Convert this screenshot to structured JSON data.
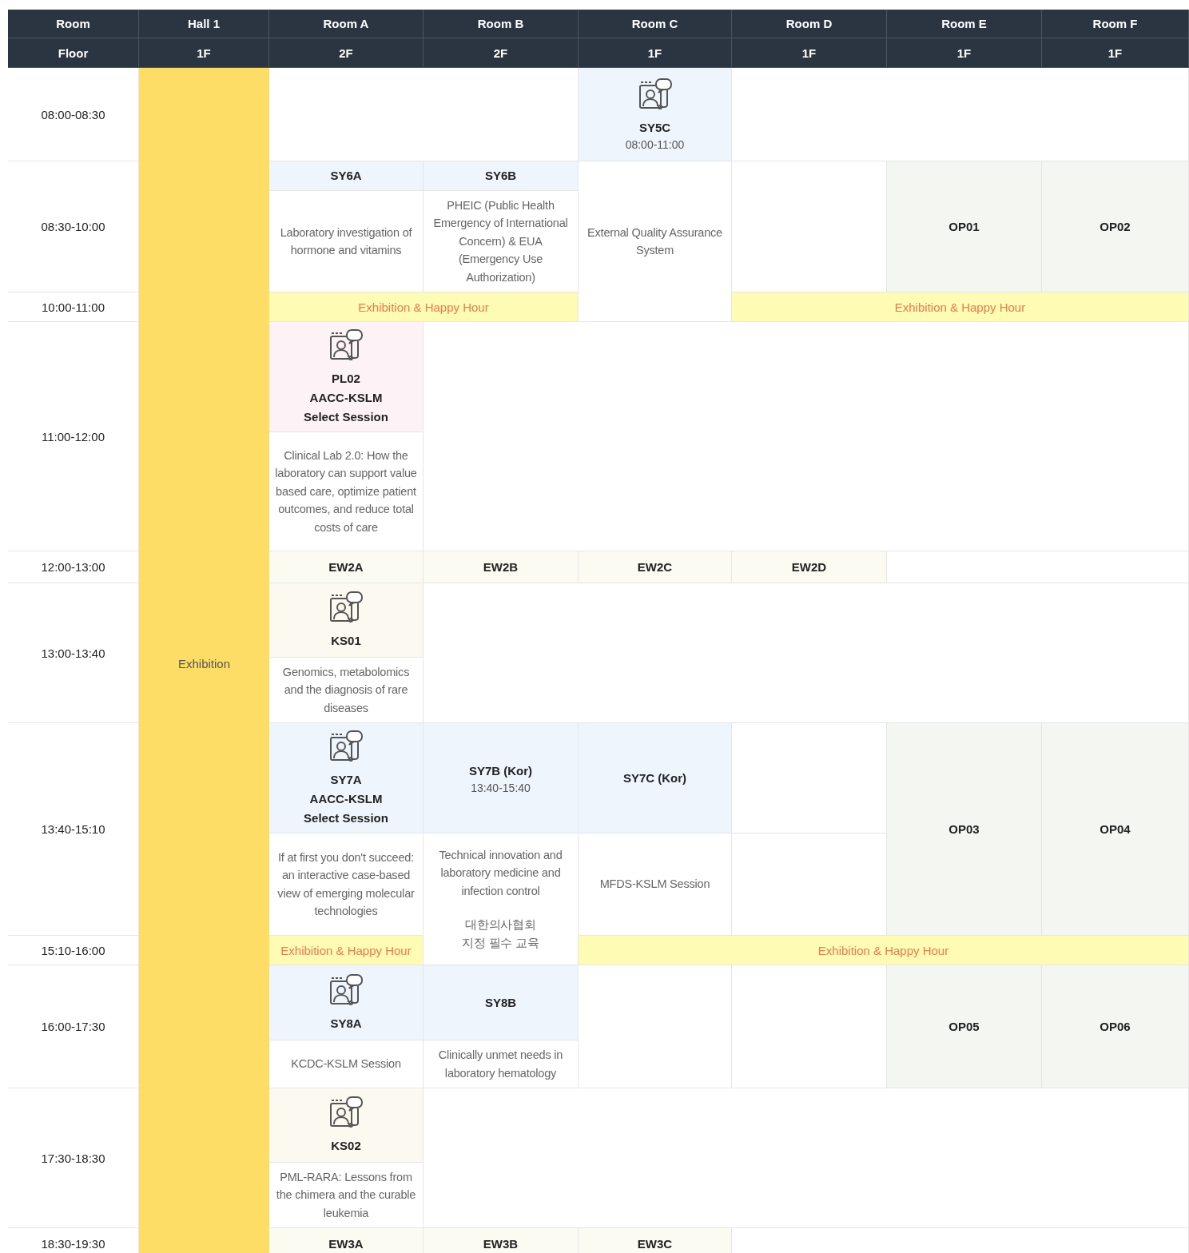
{
  "columns": [
    {
      "room": "Room",
      "floor": "Floor"
    },
    {
      "room": "Hall 1",
      "floor": "1F"
    },
    {
      "room": "Room A",
      "floor": "2F"
    },
    {
      "room": "Room B",
      "floor": "2F"
    },
    {
      "room": "Room C",
      "floor": "1F"
    },
    {
      "room": "Room D",
      "floor": "1F"
    },
    {
      "room": "Room E",
      "floor": "1F"
    },
    {
      "room": "Room F",
      "floor": "1F"
    }
  ],
  "time_slots": [
    "08:00-08:30",
    "08:30-10:00",
    "10:00-11:00",
    "11:00-12:00",
    "12:00-13:00",
    "13:00-13:40",
    "13:40-15:10",
    "15:10-16:00",
    "16:00-17:30",
    "17:30-18:30",
    "18:30-19:30"
  ],
  "hall": {
    "label": "Exhibition"
  },
  "cells": [
    {
      "kind": "session",
      "lines": [
        "SY5C"
      ],
      "time": "08:00-11:00",
      "icon": true,
      "color": "#eef5fc"
    },
    {
      "kind": "session",
      "lines": [
        "SY6A"
      ],
      "icon": false,
      "color": "#eef5fc"
    },
    {
      "kind": "session",
      "lines": [
        "SY6B"
      ],
      "icon": false,
      "color": "#eef5fc"
    },
    {
      "kind": "description",
      "text": "Laboratory investigation of hormone and vitamins"
    },
    {
      "kind": "description",
      "text": "PHEIC (Public Health Emergency of International Concern) & EUA (Emergency Use Authorization)"
    },
    {
      "kind": "description",
      "text": "External Quality Assurance System"
    },
    {
      "kind": "session",
      "lines": [
        "OP01"
      ],
      "icon": false,
      "color": "#f4f7f1"
    },
    {
      "kind": "session",
      "lines": [
        "OP02"
      ],
      "icon": false,
      "color": "#f4f7f1"
    },
    {
      "kind": "band",
      "text": "Exhibition & Happy Hour"
    },
    {
      "kind": "band",
      "text": "Exhibition & Happy Hour"
    },
    {
      "kind": "session",
      "lines": [
        "PL02",
        "AACC-KSLM",
        "Select Session"
      ],
      "icon": true,
      "color": "#fdf3f7"
    },
    {
      "kind": "description",
      "text": "Clinical Lab 2.0: How the laboratory can support value based care, optimize patient outcomes, and reduce total costs of care"
    },
    {
      "kind": "session",
      "lines": [
        "EW2A"
      ],
      "icon": false,
      "color": "#fcfbf1"
    },
    {
      "kind": "session",
      "lines": [
        "EW2B"
      ],
      "icon": false,
      "color": "#fcfbf1"
    },
    {
      "kind": "session",
      "lines": [
        "EW2C"
      ],
      "icon": false,
      "color": "#fcfbf1"
    },
    {
      "kind": "session",
      "lines": [
        "EW2D"
      ],
      "icon": false,
      "color": "#fcfbf1"
    },
    {
      "kind": "session",
      "lines": [
        "KS01"
      ],
      "icon": true,
      "color": "#fcf9f1"
    },
    {
      "kind": "description",
      "text": "Genomics, metabolomics and the diagnosis of rare diseases"
    },
    {
      "kind": "session",
      "lines": [
        "SY7A",
        "AACC-KSLM",
        "Select Session"
      ],
      "icon": true,
      "color": "#eef5fc"
    },
    {
      "kind": "session",
      "lines": [
        "SY7B (Kor)"
      ],
      "time": "13:40-15:40",
      "icon": false,
      "color": "#eef5fc"
    },
    {
      "kind": "session",
      "lines": [
        "SY7C (Kor)"
      ],
      "icon": false,
      "color": "#eef5fc"
    },
    {
      "kind": "session",
      "lines": [
        "OP03"
      ],
      "icon": false,
      "color": "#f4f7f1"
    },
    {
      "kind": "session",
      "lines": [
        "OP04"
      ],
      "icon": false,
      "color": "#f4f7f1"
    },
    {
      "kind": "description",
      "text": "If at first you don't succeed: an interactive case-based view of emerging molecular technologies"
    },
    {
      "kind": "description",
      "text": "Technical innovation and laboratory medicine and infection control",
      "note": "대한의사협회 지정 필수 교육"
    },
    {
      "kind": "description",
      "text": "MFDS-KSLM Session"
    },
    {
      "kind": "band",
      "text": "Exhibition & Happy Hour"
    },
    {
      "kind": "band",
      "text": "Exhibition & Happy Hour"
    },
    {
      "kind": "session",
      "lines": [
        "SY8A"
      ],
      "icon": true,
      "color": "#eef5fc"
    },
    {
      "kind": "session",
      "lines": [
        "SY8B"
      ],
      "icon": false,
      "color": "#eef5fc"
    },
    {
      "kind": "session",
      "lines": [
        "OP05"
      ],
      "icon": false,
      "color": "#f4f7f1"
    },
    {
      "kind": "session",
      "lines": [
        "OP06"
      ],
      "icon": false,
      "color": "#f4f7f1"
    },
    {
      "kind": "description",
      "text": "KCDC-KSLM Session"
    },
    {
      "kind": "description",
      "text": "Clinically unmet needs in laboratory hematology"
    },
    {
      "kind": "session",
      "lines": [
        "KS02"
      ],
      "icon": true,
      "color": "#fcf9f1"
    },
    {
      "kind": "description",
      "text": "PML-RARA: Lessons from the chimera and the curable leukemia"
    },
    {
      "kind": "session",
      "lines": [
        "EW3A"
      ],
      "icon": false,
      "color": "#fcfbf1"
    },
    {
      "kind": "session",
      "lines": [
        "EW3B"
      ],
      "icon": false,
      "color": "#fcfbf1"
    },
    {
      "kind": "session",
      "lines": [
        "EW3C"
      ],
      "icon": false,
      "color": "#fcfbf1"
    }
  ]
}
